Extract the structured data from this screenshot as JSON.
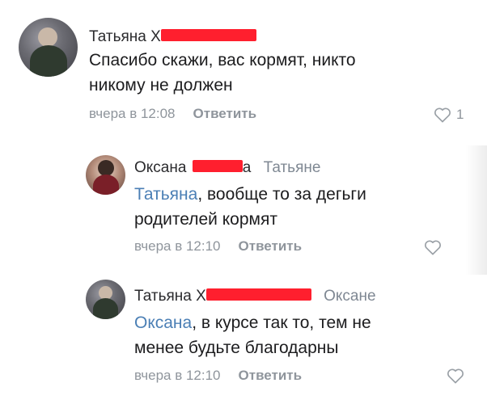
{
  "comments": [
    {
      "author_first": "Татьяна Х",
      "author_tail": "",
      "reply_to": "",
      "mention": "",
      "lines": [
        "Спасибо скажи, вас кормят, никто",
        "никому не должен"
      ],
      "time": "вчера в 12:08",
      "reply_label": "Ответить",
      "likes": "1"
    },
    {
      "author_first": "Оксана",
      "author_tail": "а",
      "reply_to": "Татьяне",
      "mention": "Татьяна",
      "lines": [
        ", вообще то за дегьги",
        "родителей кормят"
      ],
      "time": "вчера в 12:10",
      "reply_label": "Ответить",
      "likes": ""
    },
    {
      "author_first": "Татьяна Х",
      "author_tail": "",
      "reply_to": "Оксане",
      "mention": "Оксана",
      "lines": [
        ", в курсе так то, тем не",
        "менее будьте благодарны"
      ],
      "time": "вчера в 12:10",
      "reply_label": "Ответить",
      "likes": ""
    }
  ],
  "icons": {
    "avatar": "user-avatar",
    "like": "heart-outline-icon"
  },
  "colors": {
    "mention": "#4b7fb5",
    "meta": "#8f959c",
    "redaction": "#ff1f2e"
  }
}
